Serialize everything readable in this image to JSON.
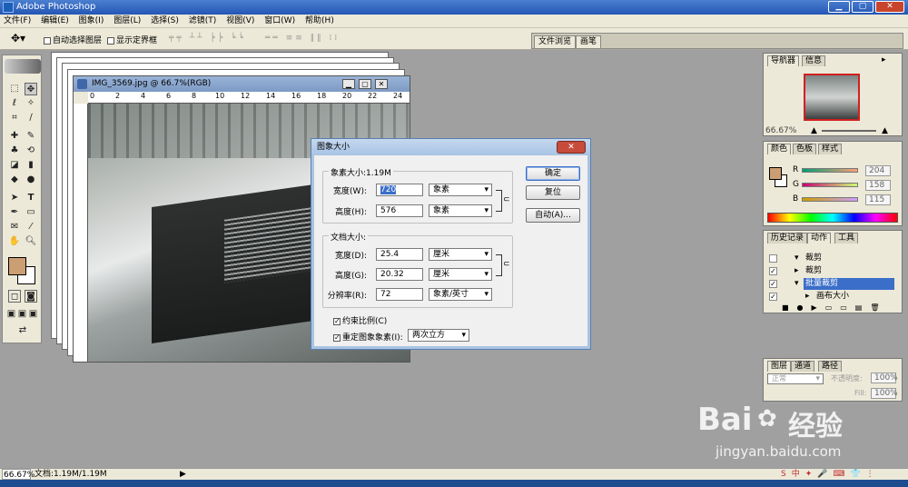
{
  "app": {
    "title": "Adobe Photoshop"
  },
  "menu": [
    "文件(F)",
    "编辑(E)",
    "图象(I)",
    "图层(L)",
    "选择(S)",
    "滤镜(T)",
    "视图(V)",
    "窗口(W)",
    "帮助(H)"
  ],
  "options": {
    "auto_select_layer": "自动选择图层",
    "show_bounds": "显示定界框"
  },
  "palette_well": {
    "tabs": [
      "文件浏览",
      "画笔"
    ]
  },
  "document": {
    "title": "IMG_3569.jpg @ 66.7%(RGB)",
    "ruler_ticks": [
      "0",
      "2",
      "4",
      "6",
      "8",
      "10",
      "12",
      "14",
      "16",
      "18",
      "20",
      "22",
      "24"
    ]
  },
  "dialog": {
    "title": "图象大小",
    "pixel_dims": {
      "label": "象素大小:1.19M",
      "width_label": "宽度(W):",
      "width_value": "720",
      "width_unit": "象素",
      "height_label": "高度(H):",
      "height_value": "576",
      "height_unit": "象素"
    },
    "doc_size": {
      "label": "文档大小:",
      "width_label": "宽度(D):",
      "width_value": "25.4",
      "width_unit": "厘米",
      "height_label": "高度(G):",
      "height_value": "20.32",
      "height_unit": "厘米",
      "res_label": "分辨率(R):",
      "res_value": "72",
      "res_unit": "象素/英寸"
    },
    "constrain": "约束比例(C)",
    "resample": "重定图象象素(I):",
    "resample_method": "两次立方",
    "ok": "确定",
    "reset": "复位",
    "auto": "自动(A)..."
  },
  "navigator": {
    "tabs": [
      "导航器",
      "信息"
    ],
    "zoom": "66.67%"
  },
  "color": {
    "tabs": [
      "颜色",
      "色板",
      "样式"
    ],
    "r_label": "R",
    "r": "204",
    "g_label": "G",
    "g": "158",
    "b_label": "B",
    "b": "115",
    "fg": "#cc9e73"
  },
  "history": {
    "tabs": [
      "历史记录",
      "动作",
      "工具"
    ],
    "rows": [
      "裁剪",
      "裁剪",
      "批量裁剪",
      "画布大小"
    ]
  },
  "layers": {
    "tabs": [
      "图层",
      "通道",
      "路径"
    ],
    "mode": "正常",
    "opacity_label": "不透明度:",
    "opacity": "100%",
    "fill_label": "Fill:",
    "fill": "100%"
  },
  "status": {
    "zoom": "66.67%",
    "doc": "文档:1.19M/1.19M"
  },
  "watermark": {
    "brand": "Bai",
    "brand2": "经验",
    "url": "jingyan.baidu.com"
  }
}
